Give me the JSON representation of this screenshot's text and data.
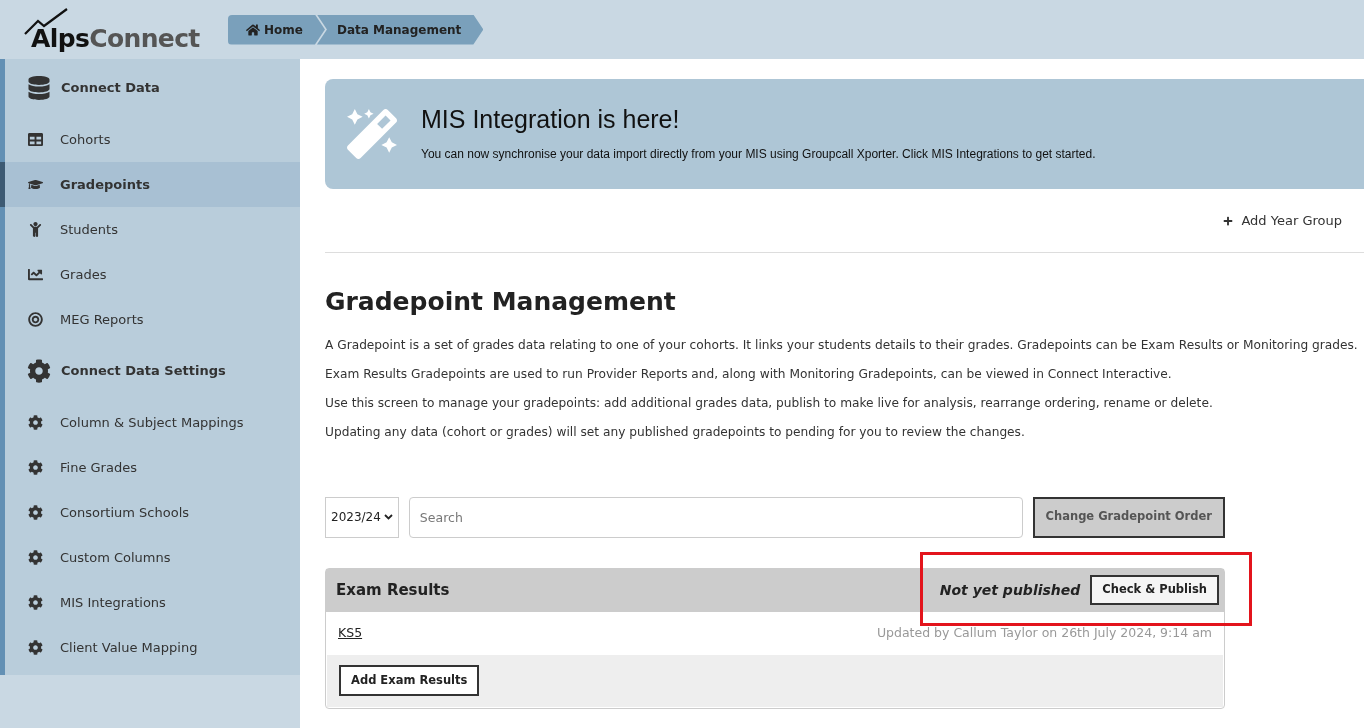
{
  "logo": {
    "bold": "Alps",
    "light": "Connect"
  },
  "breadcrumbs": [
    {
      "label": "Home"
    },
    {
      "label": "Data Management"
    }
  ],
  "sidebar": {
    "sections": [
      {
        "title": "Connect Data",
        "items": [
          {
            "label": "Cohorts",
            "selected": false
          },
          {
            "label": "Gradepoints",
            "selected": true
          },
          {
            "label": "Students",
            "selected": false
          },
          {
            "label": "Grades",
            "selected": false
          },
          {
            "label": "MEG Reports",
            "selected": false
          }
        ]
      },
      {
        "title": "Connect Data Settings",
        "items": [
          {
            "label": "Column & Subject Mappings",
            "selected": false
          },
          {
            "label": "Fine Grades",
            "selected": false
          },
          {
            "label": "Consortium Schools",
            "selected": false
          },
          {
            "label": "Custom Columns",
            "selected": false
          },
          {
            "label": "MIS Integrations",
            "selected": false
          },
          {
            "label": "Client Value Mapping",
            "selected": false
          }
        ]
      }
    ]
  },
  "banner": {
    "title": "MIS Integration is here!",
    "text": "You can now synchronise your data import directly from your MIS using Groupcall Xporter. Click MIS Integrations to get started."
  },
  "add_year_group": "Add Year Group",
  "page_title": "Gradepoint Management",
  "paragraphs": [
    "A Gradepoint is a set of grades data relating to one of your cohorts. It links your students details to their grades. Gradepoints can be Exam Results or Monitoring grades.",
    "Exam Results Gradepoints are used to run Provider Reports and, along with Monitoring Gradepoints, can be viewed in Connect Interactive.",
    "Use this screen to manage your gradepoints: add additional grades data, publish to make live for analysis, rearrange ordering, rename or delete.",
    "Updating any data (cohort or grades) will set any published gradepoints to pending for you to review the changes."
  ],
  "filters": {
    "year": "2023/24",
    "search_placeholder": "Search",
    "order_button": "Change Gradepoint Order"
  },
  "groups": [
    {
      "title": "Exam Results",
      "status": "Not yet published",
      "publish_button": "Check & Publish",
      "highlighted": true,
      "rows": [
        {
          "name": "KS5",
          "updated": "Updated by Callum Taylor on 26th July 2024, 9:14 am"
        }
      ],
      "add_button": "Add Exam Results"
    }
  ]
}
